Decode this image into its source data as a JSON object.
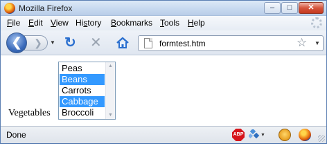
{
  "window": {
    "title": "Mozilla Firefox"
  },
  "window_controls": {
    "minimize": "–",
    "maximize": "□",
    "close": "✕"
  },
  "menu": {
    "items": [
      {
        "first": "F",
        "rest": "ile"
      },
      {
        "first": "E",
        "rest": "dit"
      },
      {
        "first": "V",
        "rest": "iew"
      },
      {
        "first": "",
        "rest": "Hi",
        "ul": "s",
        "tail": "tory"
      },
      {
        "first": "B",
        "rest": "ookmarks"
      },
      {
        "first": "T",
        "rest": "ools"
      },
      {
        "first": "H",
        "rest": "elp"
      }
    ]
  },
  "nav": {
    "back_glyph": "❮",
    "forward_glyph": "❯",
    "reload_glyph": "↻",
    "stop_glyph": "✕",
    "url": "formtest.htm",
    "star_glyph": "☆"
  },
  "form": {
    "label": "Vegetables",
    "options": [
      {
        "text": "Peas",
        "selected": false
      },
      {
        "text": "Beans",
        "selected": true
      },
      {
        "text": "Carrots",
        "selected": false
      },
      {
        "text": "Cabbage",
        "selected": true
      },
      {
        "text": "Broccoli",
        "selected": false
      }
    ]
  },
  "status": {
    "text": "Done",
    "abp_label": "ABP"
  },
  "icons": {
    "app": "firefox-icon",
    "home": "home-icon",
    "page": "page-icon",
    "bookmark": "star-icon",
    "abp": "adblock-icon",
    "face": "smiley-icon"
  }
}
